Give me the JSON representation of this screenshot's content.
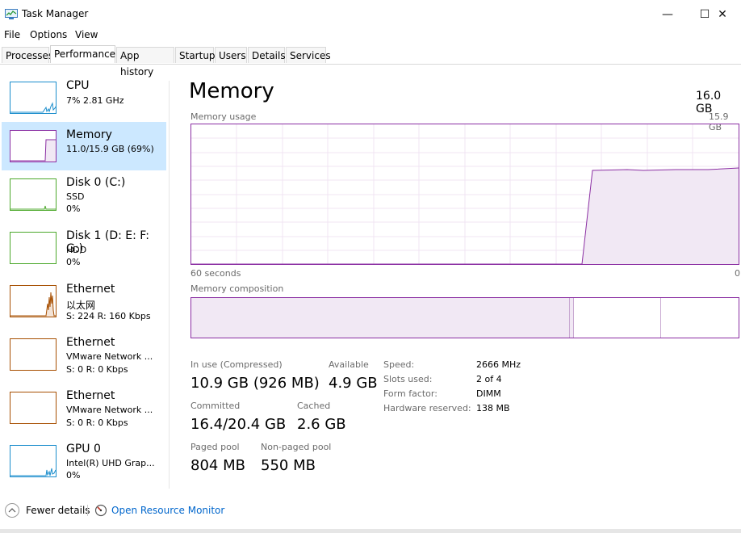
{
  "window": {
    "title": "Task Manager",
    "controls": {
      "minimize": "—",
      "maximize": "☐",
      "close": "✕"
    }
  },
  "menu": [
    "File",
    "Options",
    "View"
  ],
  "tabs": [
    {
      "label": "Processes",
      "active": false
    },
    {
      "label": "Performance",
      "active": true
    },
    {
      "label": "App history",
      "active": false
    },
    {
      "label": "Startup",
      "active": false
    },
    {
      "label": "Users",
      "active": false
    },
    {
      "label": "Details",
      "active": false
    },
    {
      "label": "Services",
      "active": false
    }
  ],
  "sidebar": {
    "items": [
      {
        "name": "CPU",
        "line1": "7%  2.81 GHz",
        "line2": "",
        "line3": "",
        "color": "#1a8dcc",
        "kind": "cpu"
      },
      {
        "name": "Memory",
        "line1": "11.0/15.9 GB (69%)",
        "line2": "",
        "line3": "",
        "color": "#8b2fa3",
        "kind": "memory",
        "selected": true
      },
      {
        "name": "Disk 0 (C:)",
        "line1": "SSD",
        "line2": "0%",
        "line3": "",
        "color": "#4ca82b",
        "kind": "disk"
      },
      {
        "name": "Disk 1 (D: E: F: G:)",
        "line1": "HDD",
        "line2": "0%",
        "line3": "",
        "color": "#4ca82b",
        "kind": "disk"
      },
      {
        "name": "Ethernet",
        "line1": "以太网",
        "line2": "S: 224  R: 160 Kbps",
        "line3": "",
        "color": "#a74f01",
        "kind": "ethernet-active"
      },
      {
        "name": "Ethernet",
        "line1": "VMware Network ...",
        "line2": "S: 0  R: 0 Kbps",
        "line3": "",
        "color": "#a74f01",
        "kind": "ethernet"
      },
      {
        "name": "Ethernet",
        "line1": "VMware Network ...",
        "line2": "S: 0  R: 0 Kbps",
        "line3": "",
        "color": "#a74f01",
        "kind": "ethernet"
      },
      {
        "name": "GPU 0",
        "line1": "Intel(R) UHD Grap...",
        "line2": "0%",
        "line3": "",
        "color": "#1a8dcc",
        "kind": "gpu"
      }
    ]
  },
  "main": {
    "title": "Memory",
    "total": "16.0 GB",
    "usage_label": "Memory usage",
    "usage_max": "15.9 GB",
    "time_left": "60 seconds",
    "time_right": "0",
    "composition_label": "Memory composition",
    "usage_fraction": 0.69
  },
  "stats": {
    "in_use_label": "In use (Compressed)",
    "in_use_value": "10.9 GB (926 MB)",
    "available_label": "Available",
    "available_value": "4.9 GB",
    "committed_label": "Committed",
    "committed_value": "16.4/20.4 GB",
    "cached_label": "Cached",
    "cached_value": "2.6 GB",
    "paged_label": "Paged pool",
    "paged_value": "804 MB",
    "nonpaged_label": "Non-paged pool",
    "nonpaged_value": "550 MB"
  },
  "specs": [
    {
      "label": "Speed:",
      "value": "2666 MHz"
    },
    {
      "label": "Slots used:",
      "value": "2 of 4"
    },
    {
      "label": "Form factor:",
      "value": "DIMM"
    },
    {
      "label": "Hardware reserved:",
      "value": "138 MB"
    }
  ],
  "footer": {
    "fewer_details": "Fewer details",
    "resource_monitor": "Open Resource Monitor"
  },
  "colors": {
    "memory": "#8b2fa3",
    "selected": "#cce8ff",
    "link": "#0066cc"
  }
}
